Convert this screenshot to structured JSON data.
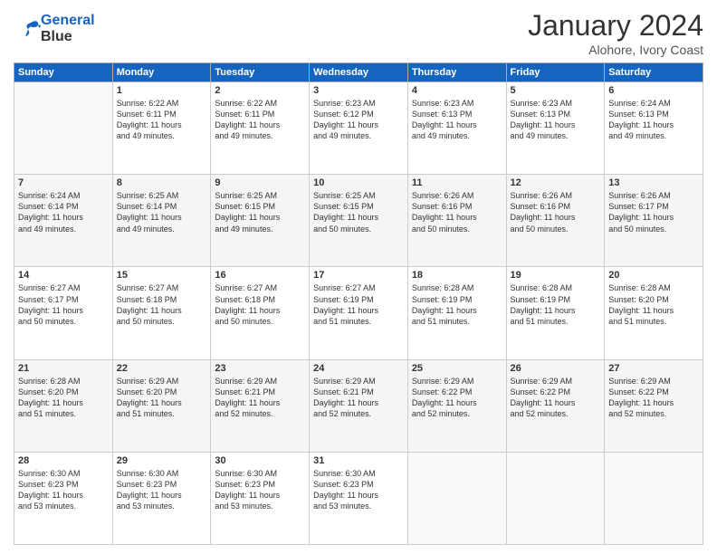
{
  "logo": {
    "line1": "General",
    "line2": "Blue"
  },
  "title": "January 2024",
  "location": "Alohore, Ivory Coast",
  "days_header": [
    "Sunday",
    "Monday",
    "Tuesday",
    "Wednesday",
    "Thursday",
    "Friday",
    "Saturday"
  ],
  "weeks": [
    [
      {
        "day": "",
        "info": ""
      },
      {
        "day": "1",
        "info": "Sunrise: 6:22 AM\nSunset: 6:11 PM\nDaylight: 11 hours\nand 49 minutes."
      },
      {
        "day": "2",
        "info": "Sunrise: 6:22 AM\nSunset: 6:11 PM\nDaylight: 11 hours\nand 49 minutes."
      },
      {
        "day": "3",
        "info": "Sunrise: 6:23 AM\nSunset: 6:12 PM\nDaylight: 11 hours\nand 49 minutes."
      },
      {
        "day": "4",
        "info": "Sunrise: 6:23 AM\nSunset: 6:13 PM\nDaylight: 11 hours\nand 49 minutes."
      },
      {
        "day": "5",
        "info": "Sunrise: 6:23 AM\nSunset: 6:13 PM\nDaylight: 11 hours\nand 49 minutes."
      },
      {
        "day": "6",
        "info": "Sunrise: 6:24 AM\nSunset: 6:13 PM\nDaylight: 11 hours\nand 49 minutes."
      }
    ],
    [
      {
        "day": "7",
        "info": "Sunrise: 6:24 AM\nSunset: 6:14 PM\nDaylight: 11 hours\nand 49 minutes."
      },
      {
        "day": "8",
        "info": "Sunrise: 6:25 AM\nSunset: 6:14 PM\nDaylight: 11 hours\nand 49 minutes."
      },
      {
        "day": "9",
        "info": "Sunrise: 6:25 AM\nSunset: 6:15 PM\nDaylight: 11 hours\nand 49 minutes."
      },
      {
        "day": "10",
        "info": "Sunrise: 6:25 AM\nSunset: 6:15 PM\nDaylight: 11 hours\nand 50 minutes."
      },
      {
        "day": "11",
        "info": "Sunrise: 6:26 AM\nSunset: 6:16 PM\nDaylight: 11 hours\nand 50 minutes."
      },
      {
        "day": "12",
        "info": "Sunrise: 6:26 AM\nSunset: 6:16 PM\nDaylight: 11 hours\nand 50 minutes."
      },
      {
        "day": "13",
        "info": "Sunrise: 6:26 AM\nSunset: 6:17 PM\nDaylight: 11 hours\nand 50 minutes."
      }
    ],
    [
      {
        "day": "14",
        "info": "Sunrise: 6:27 AM\nSunset: 6:17 PM\nDaylight: 11 hours\nand 50 minutes."
      },
      {
        "day": "15",
        "info": "Sunrise: 6:27 AM\nSunset: 6:18 PM\nDaylight: 11 hours\nand 50 minutes."
      },
      {
        "day": "16",
        "info": "Sunrise: 6:27 AM\nSunset: 6:18 PM\nDaylight: 11 hours\nand 50 minutes."
      },
      {
        "day": "17",
        "info": "Sunrise: 6:27 AM\nSunset: 6:19 PM\nDaylight: 11 hours\nand 51 minutes."
      },
      {
        "day": "18",
        "info": "Sunrise: 6:28 AM\nSunset: 6:19 PM\nDaylight: 11 hours\nand 51 minutes."
      },
      {
        "day": "19",
        "info": "Sunrise: 6:28 AM\nSunset: 6:19 PM\nDaylight: 11 hours\nand 51 minutes."
      },
      {
        "day": "20",
        "info": "Sunrise: 6:28 AM\nSunset: 6:20 PM\nDaylight: 11 hours\nand 51 minutes."
      }
    ],
    [
      {
        "day": "21",
        "info": "Sunrise: 6:28 AM\nSunset: 6:20 PM\nDaylight: 11 hours\nand 51 minutes."
      },
      {
        "day": "22",
        "info": "Sunrise: 6:29 AM\nSunset: 6:20 PM\nDaylight: 11 hours\nand 51 minutes."
      },
      {
        "day": "23",
        "info": "Sunrise: 6:29 AM\nSunset: 6:21 PM\nDaylight: 11 hours\nand 52 minutes."
      },
      {
        "day": "24",
        "info": "Sunrise: 6:29 AM\nSunset: 6:21 PM\nDaylight: 11 hours\nand 52 minutes."
      },
      {
        "day": "25",
        "info": "Sunrise: 6:29 AM\nSunset: 6:22 PM\nDaylight: 11 hours\nand 52 minutes."
      },
      {
        "day": "26",
        "info": "Sunrise: 6:29 AM\nSunset: 6:22 PM\nDaylight: 11 hours\nand 52 minutes."
      },
      {
        "day": "27",
        "info": "Sunrise: 6:29 AM\nSunset: 6:22 PM\nDaylight: 11 hours\nand 52 minutes."
      }
    ],
    [
      {
        "day": "28",
        "info": "Sunrise: 6:30 AM\nSunset: 6:23 PM\nDaylight: 11 hours\nand 53 minutes."
      },
      {
        "day": "29",
        "info": "Sunrise: 6:30 AM\nSunset: 6:23 PM\nDaylight: 11 hours\nand 53 minutes."
      },
      {
        "day": "30",
        "info": "Sunrise: 6:30 AM\nSunset: 6:23 PM\nDaylight: 11 hours\nand 53 minutes."
      },
      {
        "day": "31",
        "info": "Sunrise: 6:30 AM\nSunset: 6:23 PM\nDaylight: 11 hours\nand 53 minutes."
      },
      {
        "day": "",
        "info": ""
      },
      {
        "day": "",
        "info": ""
      },
      {
        "day": "",
        "info": ""
      }
    ]
  ]
}
